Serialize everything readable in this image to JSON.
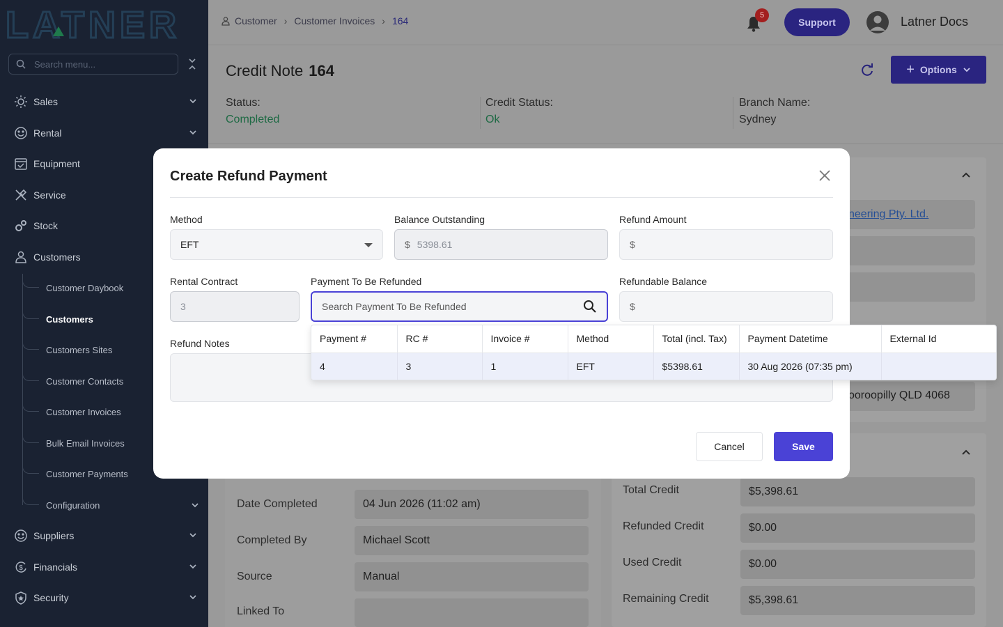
{
  "sidebar": {
    "logo_text": "LATNER",
    "search_placeholder": "Search menu...",
    "items": [
      {
        "label": "Sales",
        "icon": "sun-icon"
      },
      {
        "label": "Rental",
        "icon": "face-icon"
      },
      {
        "label": "Equipment",
        "icon": "calendar-check-icon"
      },
      {
        "label": "Service",
        "icon": "tools-icon"
      },
      {
        "label": "Stock",
        "icon": "gears-icon"
      },
      {
        "label": "Customers",
        "icon": "person-icon"
      }
    ],
    "sub_items": [
      {
        "label": "Customer Daybook"
      },
      {
        "label": "Customers"
      },
      {
        "label": "Customers Sites"
      },
      {
        "label": "Customer Contacts"
      },
      {
        "label": "Customer Invoices"
      },
      {
        "label": "Bulk Email Invoices"
      },
      {
        "label": "Customer Payments"
      },
      {
        "label": "Configuration"
      }
    ],
    "bottom_items": [
      {
        "label": "Suppliers",
        "icon": "face-icon"
      },
      {
        "label": "Financials",
        "icon": "dollar-cycle-icon"
      },
      {
        "label": "Security",
        "icon": "shield-icon"
      }
    ]
  },
  "topbar": {
    "breadcrumb": [
      "Customer",
      "Customer Invoices",
      "164"
    ],
    "notifications": "5",
    "support_label": "Support",
    "user_name": "Latner Docs"
  },
  "page": {
    "title": "Credit Note",
    "number": "164",
    "options_label": "Options",
    "status_label": "Status:",
    "status_value": "Completed",
    "credit_status_label": "Credit Status:",
    "credit_status_value": "Ok",
    "branch_label": "Branch Name:",
    "branch_value": "Sydney",
    "customer_link": "neering Pty. Ltd.",
    "address": "ooroopilly QLD 4068",
    "details": [
      {
        "label": "Date Completed",
        "value": "04 Jun 2026 (11:02 am)"
      },
      {
        "label": "Completed By",
        "value": "Michael Scott"
      },
      {
        "label": "Source",
        "value": "Manual"
      },
      {
        "label": "Linked To",
        "value": ""
      }
    ],
    "credits": [
      {
        "label": "Total Credit",
        "value": "$5,398.61"
      },
      {
        "label": "Refunded Credit",
        "value": "$0.00"
      },
      {
        "label": "Used Credit",
        "value": "$0.00"
      },
      {
        "label": "Remaining Credit",
        "value": "$5,398.61"
      }
    ]
  },
  "modal": {
    "title": "Create Refund Payment",
    "method_label": "Method",
    "method_value": "EFT",
    "balance_label": "Balance Outstanding",
    "currency": "$",
    "balance_value": "5398.61",
    "refund_amount_label": "Refund Amount",
    "rental_contract_label": "Rental Contract",
    "rental_contract_value": "3",
    "payment_label": "Payment To Be Refunded",
    "payment_placeholder": "Search Payment To Be Refunded",
    "refundable_label": "Refundable Balance",
    "notes_label": "Refund Notes",
    "cancel_label": "Cancel",
    "save_label": "Save"
  },
  "dropdown": {
    "columns": [
      "Payment #",
      "RC #",
      "Invoice #",
      "Method",
      "Total (incl. Tax)",
      "Payment Datetime",
      "External Id"
    ],
    "rows": [
      [
        "4",
        "3",
        "1",
        "EFT",
        "$5398.61",
        "30 Aug 2026 (07:35 pm)",
        ""
      ]
    ]
  }
}
